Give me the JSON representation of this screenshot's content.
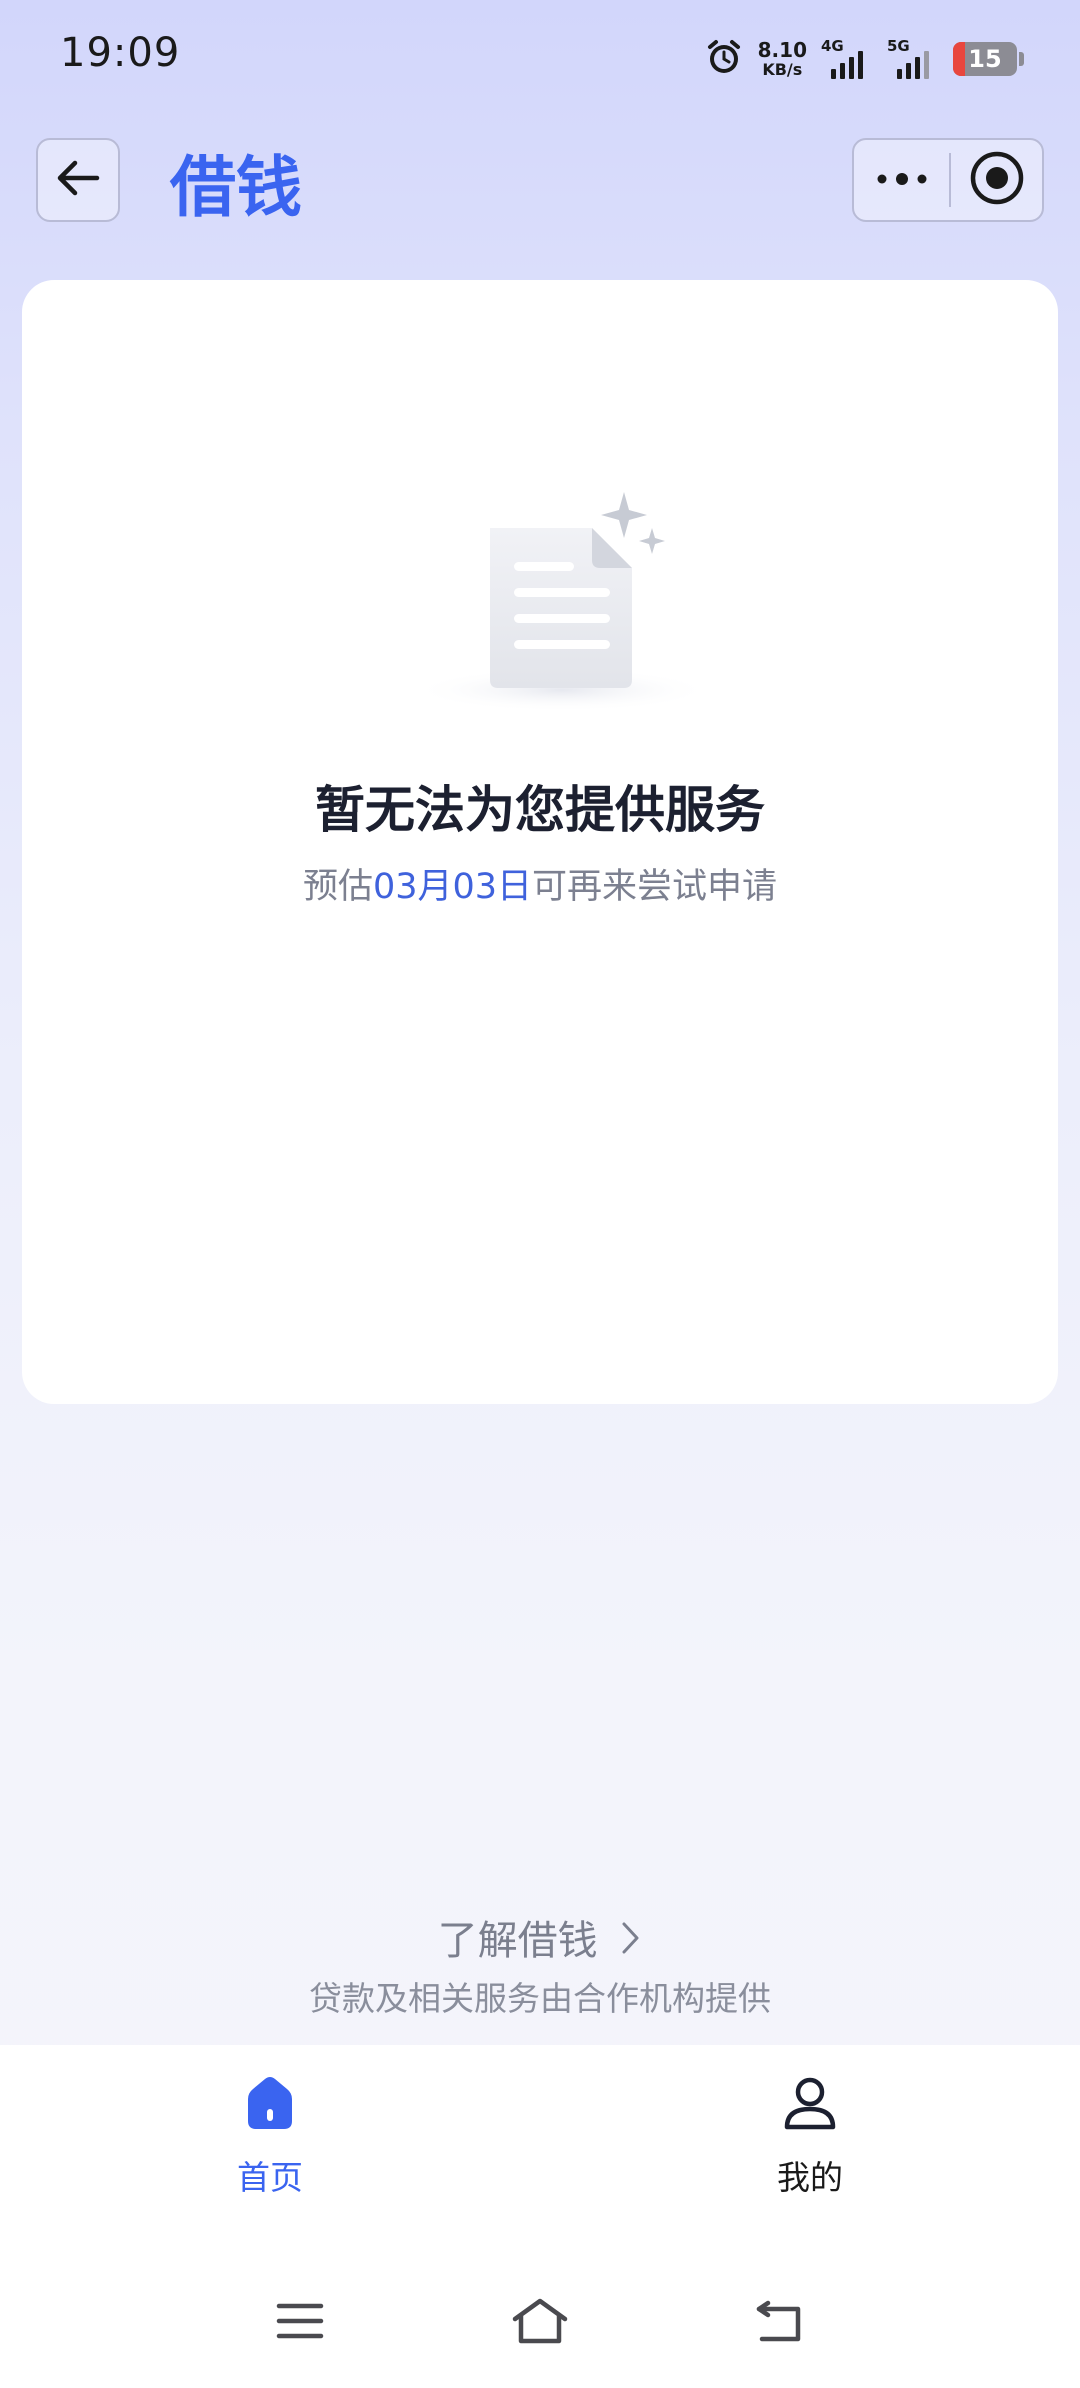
{
  "status_bar": {
    "time": "19:09",
    "speed_value": "8.10",
    "speed_unit": "KB/s",
    "sim1": "4G",
    "sim2": "5G",
    "battery": "15",
    "icons": [
      "alarm-icon",
      "signal-icon",
      "battery-icon"
    ]
  },
  "header": {
    "title": "借钱",
    "icons": [
      "back-arrow-icon",
      "more-dots-icon",
      "close-miniprogram-icon"
    ]
  },
  "empty_state": {
    "icon": "document-sparkle-icon",
    "title": "暂无法为您提供服务",
    "sub_prefix": "预估",
    "sub_date": "03月03日",
    "sub_suffix": "可再来尝试申请"
  },
  "footer": {
    "learn_label": "了解借钱",
    "disclaimer": "贷款及相关服务由合作机构提供"
  },
  "tab_bar": {
    "items": [
      {
        "label": "首页",
        "icon": "home-icon",
        "active": true
      },
      {
        "label": "我的",
        "icon": "user-icon",
        "active": false
      }
    ]
  },
  "system_nav": {
    "icons": [
      "menu-icon",
      "home-outline-icon",
      "back-icon"
    ]
  },
  "colors": {
    "accent": "#3a64f0",
    "date_highlight": "#3f62dc",
    "title_text": "#1c2030",
    "muted_text": "#7c8090"
  }
}
